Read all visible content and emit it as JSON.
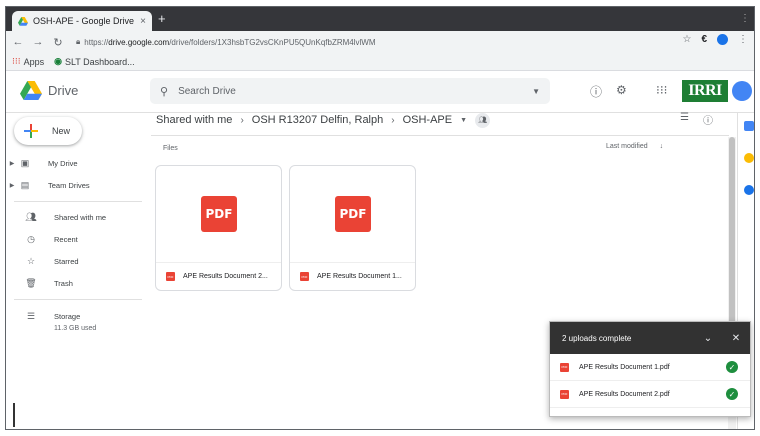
{
  "browser": {
    "tab_title": "OSH-APE - Google Drive",
    "tab_close": "×",
    "new_tab": "+",
    "url_prefix": "https://",
    "url_host": "drive.google.com",
    "url_path": "/drive/folders/1X3hsbTG2vsCKnPU5QUnKqfbZRM4lvlWM",
    "bookmarks": [
      {
        "icon": "apps-grid-icon",
        "label": "Apps"
      },
      {
        "icon": "slt-icon",
        "label": "SLT Dashboard..."
      }
    ]
  },
  "drive": {
    "product_name": "Drive",
    "search_placeholder": "Search Drive",
    "brand_logo_text": "IRRI"
  },
  "sidebar": {
    "new_label": "New",
    "items": [
      {
        "label": "My Drive",
        "icon": "my-drive-icon",
        "expandable": true
      },
      {
        "label": "Team Drives",
        "icon": "team-drives-icon",
        "expandable": true
      },
      {
        "label": "Shared with me",
        "icon": "shared-with-me-icon",
        "expandable": false
      },
      {
        "label": "Recent",
        "icon": "clock-icon",
        "expandable": false
      },
      {
        "label": "Starred",
        "icon": "star-icon",
        "expandable": false
      },
      {
        "label": "Trash",
        "icon": "trash-icon",
        "expandable": false
      }
    ],
    "storage_label": "Storage",
    "storage_used": "11.3 GB used"
  },
  "breadcrumb": {
    "items": [
      "Shared with me",
      "OSH R13207 Delfin, Ralph",
      "OSH-APE"
    ]
  },
  "main": {
    "files_label": "Files",
    "sort_label": "Last modified",
    "files": [
      {
        "name": "APE Results Document 2...",
        "thumb_text": "PDF",
        "icon_text": "PDF"
      },
      {
        "name": "APE Results Document 1...",
        "thumb_text": "PDF",
        "icon_text": "PDF"
      }
    ]
  },
  "uploads": {
    "title": "2 uploads complete",
    "items": [
      {
        "name": "APE Results Document 1.pdf",
        "icon_text": "PDF"
      },
      {
        "name": "APE Results Document 2.pdf",
        "icon_text": "PDF"
      }
    ]
  },
  "colors": {
    "pdf_red": "#ea4335",
    "success_green": "#1e8e3e",
    "brand_green": "#1e7e34",
    "toast_dark": "#323232"
  }
}
